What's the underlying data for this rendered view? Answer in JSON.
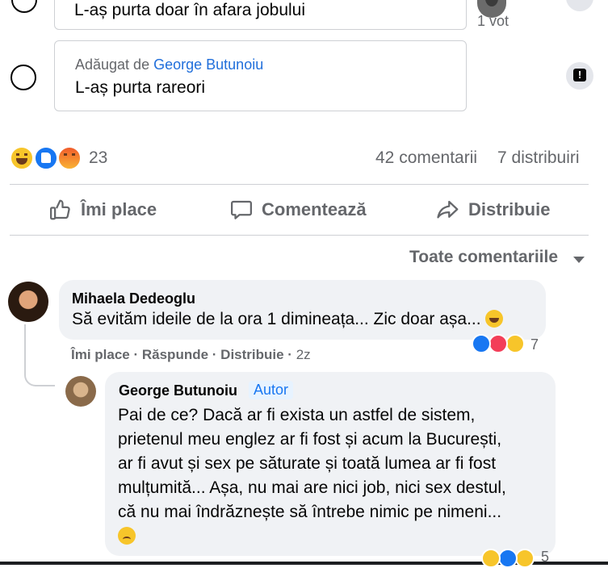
{
  "poll": {
    "option_1_text": "L-aș purta doar în afara jobului",
    "option_1_votes": "1 vot",
    "option_2_added_prefix": "Adăugat de",
    "option_2_added_author": "George Butunoiu",
    "option_2_text": "L-aș purta rareori"
  },
  "reactions": {
    "count": "23",
    "comments": "42 comentarii",
    "shares": "7 distribuiri"
  },
  "actions": {
    "like": "Îmi place",
    "comment": "Comentează",
    "share": "Distribuie"
  },
  "filter": {
    "label": "Toate comentariile"
  },
  "comments": [
    {
      "author": "Mihaela Dedeoglu",
      "text": "Să evităm ideile de la ora 1 dimineața... Zic doar așa...",
      "like": "Îmi place",
      "reply": "Răspunde",
      "share": "Distribuie",
      "time": "2z",
      "reaction_count": "7"
    },
    {
      "author": "George Butunoiu",
      "badge": "Autor",
      "lines": [
        "Pai de ce? Dacă ar fi exista un astfel de sistem,",
        "prietenul meu englez ar fi fost și acum la București,",
        "ar fi avut și sex pe săturate și toată lumea ar fi fost",
        "mulțumită... Așa, nu mai are nici job, nici sex destul,",
        "că nu mai îndrăznește să întrebe nimic pe nimeni..."
      ],
      "reaction_count": "5"
    }
  ],
  "colors": {
    "link": "#216fdb",
    "secondary_text": "#65676b",
    "bubble": "#f0f2f5",
    "divider": "#ced0d4"
  }
}
